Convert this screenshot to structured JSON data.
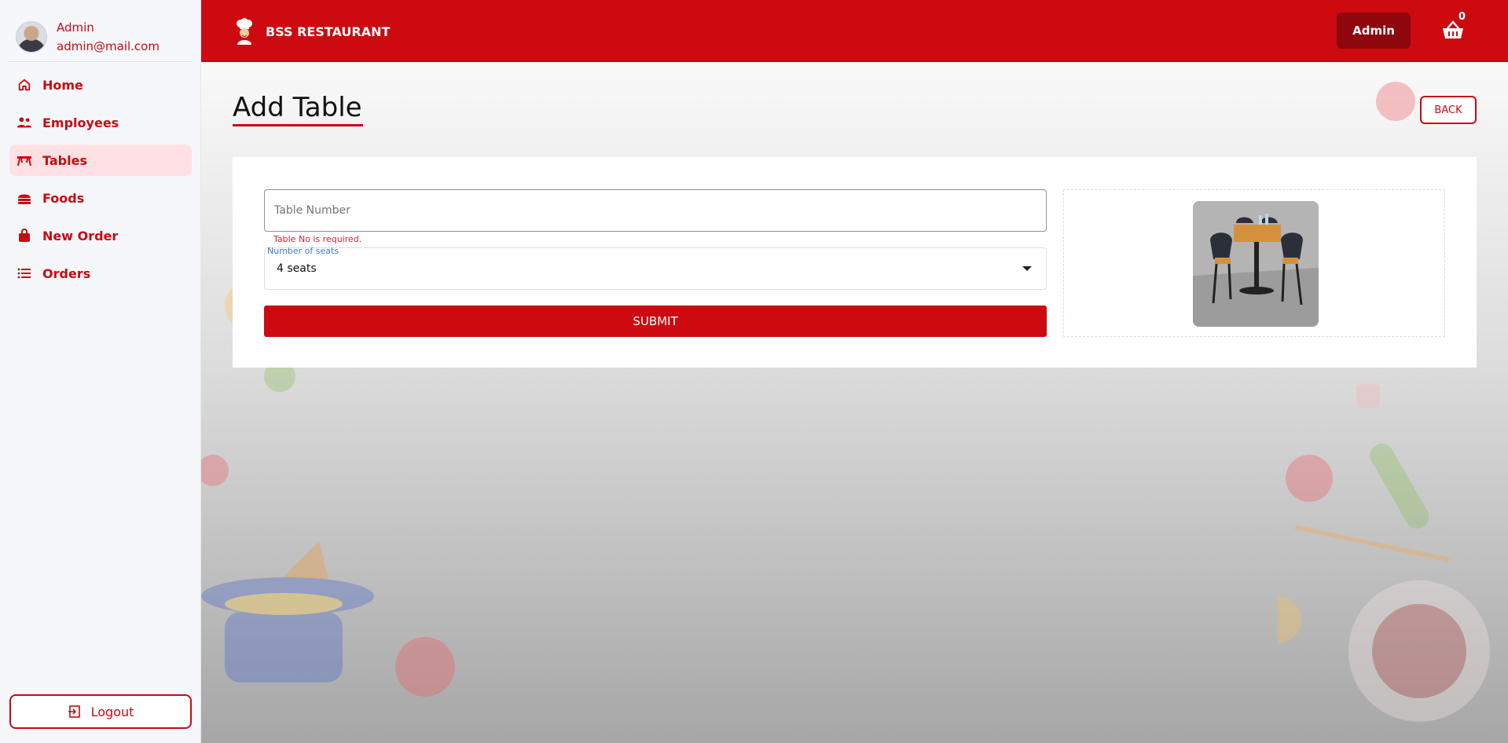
{
  "user": {
    "name": "Admin",
    "email": "admin@mail.com"
  },
  "nav": [
    {
      "label": "Home",
      "icon": "home-icon",
      "active": false
    },
    {
      "label": "Employees",
      "icon": "users-icon",
      "active": false
    },
    {
      "label": "Tables",
      "icon": "table-icon",
      "active": true
    },
    {
      "label": "Foods",
      "icon": "food-icon",
      "active": false
    },
    {
      "label": "New Order",
      "icon": "shopping-bag-icon",
      "active": false
    },
    {
      "label": "Orders",
      "icon": "list-icon",
      "active": false
    }
  ],
  "logout_label": "Logout",
  "topbar": {
    "brand": "BSS RESTAURANT",
    "admin_button": "Admin",
    "cart_count": "0"
  },
  "page": {
    "title": "Add Table",
    "back_label": "BACK",
    "form": {
      "table_number_placeholder": "Table Number",
      "table_number_value": "",
      "error": "Table No is required.",
      "seats_label": "Number of seats",
      "seats_value": "4 seats",
      "submit_label": "SUBMIT"
    }
  },
  "colors": {
    "primary": "#cc0a10",
    "dark_primary": "#8e070c",
    "active_bg": "#ffe1e4"
  }
}
